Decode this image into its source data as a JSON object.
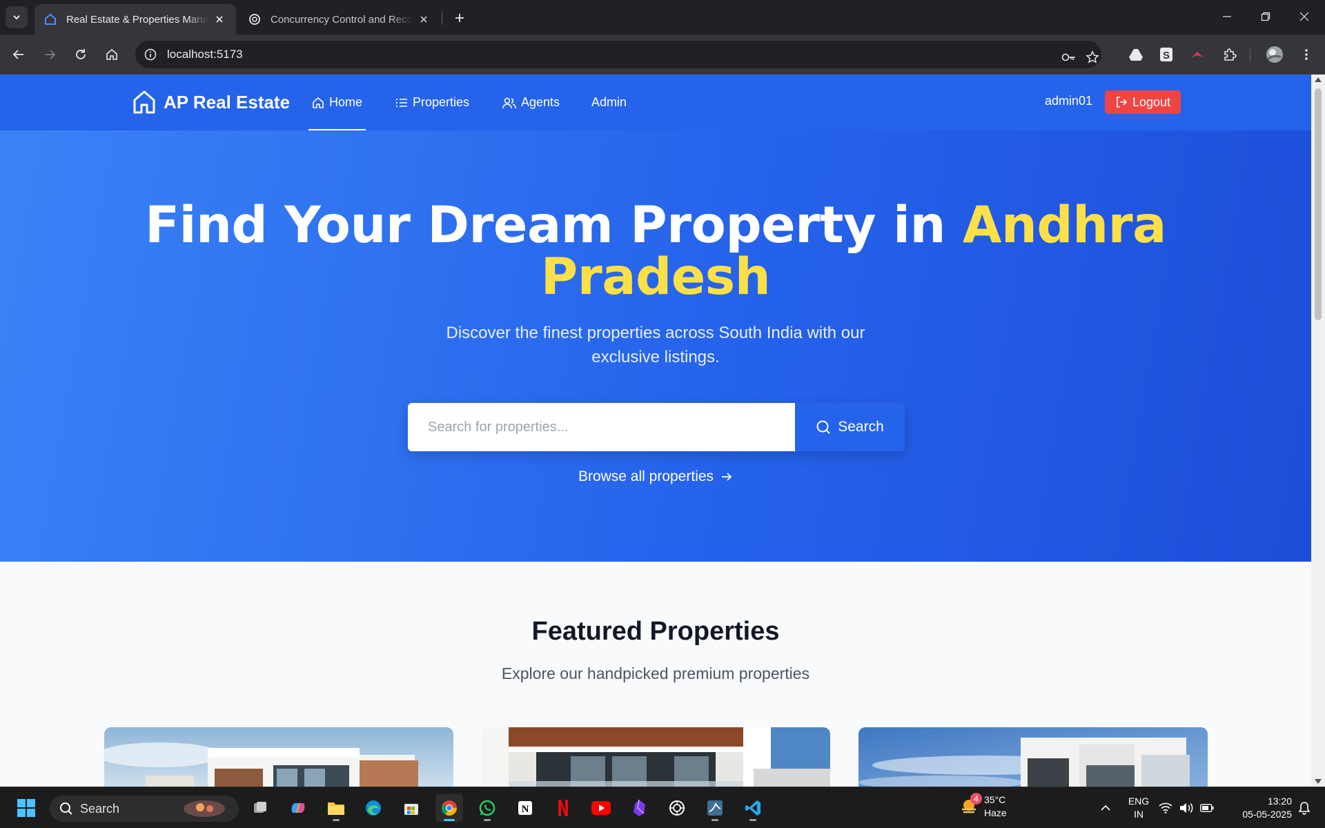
{
  "browser": {
    "tabs": [
      {
        "title": "Real Estate & Properties Management",
        "active": true
      },
      {
        "title": "Concurrency Control and Recovery",
        "active": false
      }
    ],
    "url": "localhost:5173"
  },
  "site": {
    "brand": "AP Real Estate",
    "nav": [
      {
        "label": "Home",
        "icon": "home-icon",
        "active": true
      },
      {
        "label": "Properties",
        "icon": "list-icon",
        "active": false
      },
      {
        "label": "Agents",
        "icon": "users-icon",
        "active": false
      },
      {
        "label": "Admin",
        "icon": "",
        "active": false
      }
    ],
    "user": "admin01",
    "logout_label": "Logout",
    "colors": {
      "primary": "#2563eb",
      "accent": "#fde047",
      "danger": "#ef4444"
    }
  },
  "hero": {
    "title_main": "Find Your Dream Property in",
    "title_highlight_1": "Andhra",
    "title_highlight_2": "Pradesh",
    "subtitle": "Discover the finest properties across South India with our exclusive listings.",
    "search_placeholder": "Search for properties...",
    "search_button": "Search",
    "browse_link": "Browse all properties"
  },
  "featured": {
    "title": "Featured Properties",
    "subtitle": "Explore our handpicked premium properties"
  },
  "taskbar": {
    "search_label": "Search",
    "weather": {
      "temp": "35°C",
      "condition": "Haze",
      "badge": "4"
    },
    "lang_1": "ENG",
    "lang_2": "IN",
    "time": "13:20",
    "date": "05-05-2025"
  }
}
